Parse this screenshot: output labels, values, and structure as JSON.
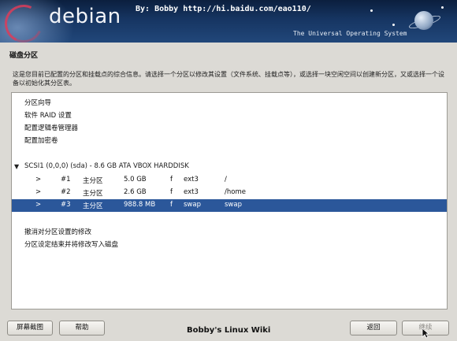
{
  "banner": {
    "logo": "debian",
    "byline": "By: Bobby  http://hi.baidu.com/eao110/",
    "tagline": "The Universal Operating System"
  },
  "page": {
    "title": "磁盘分区",
    "description": "这是您目前已配置的分区和挂载点的综合信息。请选择一个分区以修改其设置（文件系统、挂载点等），或选择一块空闲空间以创建新分区，又或选择一个设备以初始化其分区表。"
  },
  "actions_top": [
    "分区向导",
    "软件 RAID 设置",
    "配置逻辑卷管理器",
    "配置加密卷"
  ],
  "disk": {
    "label": "SCSI1 (0,0,0) (sda) - 8.6 GB ATA VBOX HARDDISK",
    "partitions": [
      {
        "arrow": ">",
        "num": "#1",
        "type": "主分区",
        "size": "5.0 GB",
        "flag": "f",
        "fs": "ext3",
        "mount": "/"
      },
      {
        "arrow": ">",
        "num": "#2",
        "type": "主分区",
        "size": "2.6 GB",
        "flag": "f",
        "fs": "ext3",
        "mount": "/home"
      },
      {
        "arrow": ">",
        "num": "#3",
        "type": "主分区",
        "size": "988.8 MB",
        "flag": "f",
        "fs": "swap",
        "mount": "swap"
      }
    ],
    "selected_index": 2
  },
  "actions_bottom": [
    "撤消对分区设置的修改",
    "分区设定结束并将修改写入磁盘"
  ],
  "footer": {
    "screenshot_label": "屏幕截图",
    "help_label": "帮助",
    "watermark": "Bobby's Linux Wiki",
    "back_label": "返回",
    "continue_label": "继续"
  },
  "colors": {
    "selection": "#2b579a",
    "banner_dark": "#0b1f3e"
  }
}
